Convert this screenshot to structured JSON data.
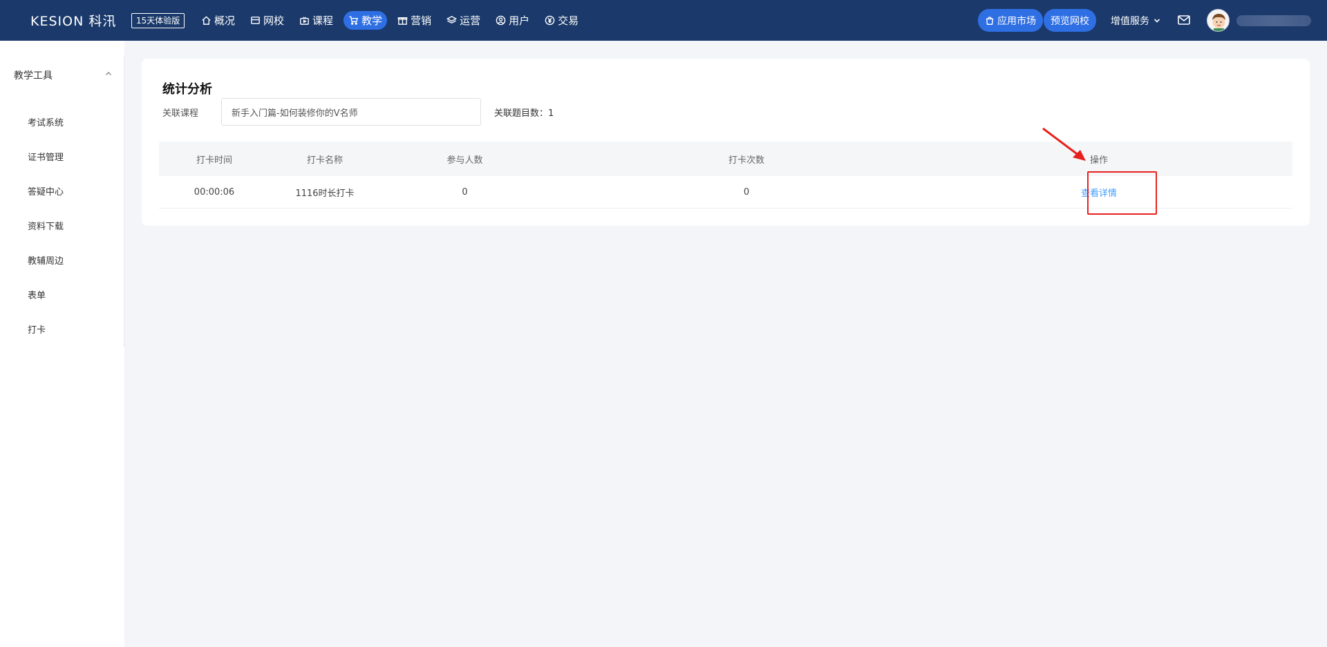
{
  "header": {
    "logo": "KESION 科汛",
    "trial_badge": "15天体验版",
    "nav": [
      {
        "label": "概况",
        "icon": "home-icon"
      },
      {
        "label": "网校",
        "icon": "store-icon"
      },
      {
        "label": "课程",
        "icon": "video-icon"
      },
      {
        "label": "教学",
        "icon": "cart-icon",
        "active": true
      },
      {
        "label": "营销",
        "icon": "gift-icon"
      },
      {
        "label": "运营",
        "icon": "layers-icon"
      },
      {
        "label": "用户",
        "icon": "user-circle-icon"
      },
      {
        "label": "交易",
        "icon": "yen-icon"
      }
    ],
    "app_market": "应用市场",
    "preview_school": "预览网校",
    "value_added": "增值服务"
  },
  "sidebar": {
    "group_label": "教学工具",
    "items": [
      "考试系统",
      "证书管理",
      "答疑中心",
      "资料下载",
      "教辅周边",
      "表单",
      "打卡"
    ]
  },
  "main": {
    "title": "统计分析",
    "course_label": "关联课程",
    "course_value": "新手入门篇-如何装修你的V名师",
    "question_count": "关联题目数：1",
    "table": {
      "headers": [
        "打卡时间",
        "打卡名称",
        "参与人数",
        "打卡次数",
        "操作"
      ],
      "rows": [
        {
          "time": "00:00:06",
          "name": "1116时长打卡",
          "participants": "0",
          "count": "0",
          "action": "查看详情"
        }
      ]
    }
  },
  "colors": {
    "header_bg": "#1b3a6b",
    "accent": "#2f6fe4",
    "link": "#409eff",
    "annotation": "#e8201c"
  }
}
